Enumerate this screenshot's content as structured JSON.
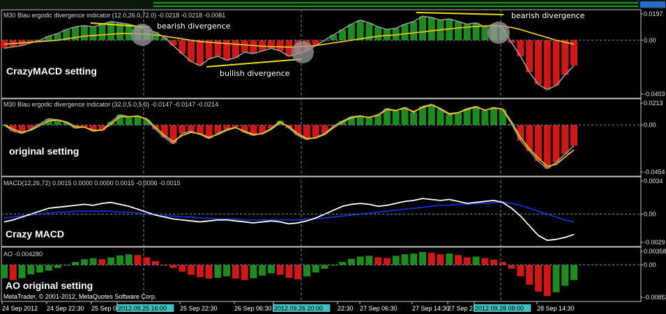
{
  "colors": {
    "background": "#000000",
    "panel_border": "#c8c8c8",
    "grid": "#6a8a9a",
    "bar_up": "#1f8a1f",
    "bar_down": "#d01818",
    "line_price": "#9a9a9a",
    "line_signal": "#e8c020",
    "macd_main": "#ffffff",
    "macd_signal": "#1030d0",
    "annotation_line": "#f0e000",
    "highlight_bg": "#40c0c0"
  },
  "chart_data": [
    {
      "type": "bar",
      "panel": 1,
      "header": "M30 Blau ergodic divergence indicator (12.0,26.0,72.0) -0.0218 -0.0218 -0.0081",
      "setting_label": "CrazyMACD setting",
      "y_ticks": [
        "0.0197",
        "0.00",
        "-0.0403"
      ],
      "ylim": [
        -0.0403,
        0.0197
      ],
      "annotations": [
        "bearish divergence",
        "bullish divergence",
        "bearish divergence"
      ],
      "series": [
        {
          "name": "",
          "type": "bar",
          "values": [
            -0.006,
            -0.005,
            -0.004,
            -0.002,
            0.0,
            0.003,
            0.005,
            0.008,
            0.01,
            0.011,
            0.01,
            0.012,
            0.014,
            0.013,
            0.012,
            0.01,
            0.008,
            0.006,
            0.002,
            -0.004,
            -0.01,
            -0.016,
            -0.019,
            -0.014,
            -0.012,
            -0.015,
            -0.013,
            -0.009,
            -0.01,
            -0.008,
            -0.006,
            -0.008,
            -0.012,
            -0.01,
            -0.008,
            -0.004,
            0.0,
            0.004,
            0.008,
            0.012,
            0.015,
            0.013,
            0.01,
            0.008,
            0.009,
            0.012,
            0.014,
            0.018,
            0.017,
            0.015,
            0.016,
            0.014,
            0.012,
            0.013,
            0.01,
            0.012,
            0.009,
            -0.002,
            -0.012,
            -0.024,
            -0.033,
            -0.037,
            -0.034,
            -0.026,
            -0.019
          ]
        },
        {
          "name": "",
          "type": "line",
          "values": [
            -0.003,
            -0.0025,
            -0.002,
            -0.0015,
            -0.001,
            -0.0005,
            0.0,
            0.001,
            0.002,
            0.003,
            0.0035,
            0.004,
            0.0045,
            0.005,
            0.005,
            0.0048,
            0.0045,
            0.004,
            0.003,
            0.002,
            0.001,
            0.0,
            -0.001,
            -0.0015,
            -0.002,
            -0.0025,
            -0.003,
            -0.0035,
            -0.004,
            -0.0045,
            -0.0048,
            -0.005,
            -0.0052,
            -0.005,
            -0.0045,
            -0.004,
            -0.003,
            -0.002,
            -0.001,
            0.0,
            0.001,
            0.002,
            0.003,
            0.0035,
            0.004,
            0.0048,
            0.0055,
            0.0062,
            0.007,
            0.0078,
            0.0085,
            0.0092,
            0.0098,
            0.0103,
            0.0107,
            0.0108,
            0.0105,
            0.0095,
            0.008,
            0.006,
            0.004,
            0.002,
            0.0,
            -0.0015,
            -0.003
          ]
        }
      ]
    },
    {
      "type": "bar",
      "panel": 2,
      "header": "M30 Blau ergodic divergence indicator (32.0,5.0,5.0) -0.0147 -0.0147 -0.0214",
      "setting_label": "original setting",
      "y_ticks": [
        "0.0213",
        "0.00",
        "-0.0454"
      ],
      "ylim": [
        -0.0454,
        0.0213
      ],
      "series": [
        {
          "name": "",
          "type": "bar",
          "values": [
            0.0,
            -0.006,
            -0.008,
            -0.004,
            0.001,
            0.006,
            0.005,
            0.002,
            -0.003,
            -0.002,
            -0.006,
            -0.005,
            0.003,
            0.01,
            0.008,
            0.009,
            0.005,
            -0.004,
            -0.012,
            -0.018,
            -0.008,
            -0.006,
            -0.009,
            -0.013,
            -0.008,
            -0.004,
            -0.002,
            -0.007,
            -0.01,
            -0.008,
            -0.003,
            0.004,
            -0.003,
            -0.01,
            -0.014,
            -0.012,
            -0.008,
            -0.001,
            0.004,
            0.008,
            0.009,
            0.007,
            0.01,
            0.016,
            0.014,
            0.017,
            0.012,
            0.018,
            0.02,
            0.015,
            0.01,
            0.012,
            0.016,
            0.018,
            0.014,
            0.017,
            0.015,
            0.001,
            -0.015,
            -0.025,
            -0.035,
            -0.042,
            -0.036,
            -0.028,
            -0.02
          ]
        },
        {
          "name": "",
          "type": "line",
          "values": [
            0.0005,
            -0.004,
            -0.007,
            -0.005,
            -0.0005,
            0.004,
            0.005,
            0.003,
            -0.0015,
            -0.002,
            -0.005,
            -0.005,
            0.001,
            0.008,
            0.008,
            0.0085,
            0.006,
            -0.002,
            -0.01,
            -0.016,
            -0.01,
            -0.007,
            -0.0085,
            -0.012,
            -0.009,
            -0.005,
            -0.0025,
            -0.006,
            -0.009,
            -0.0085,
            -0.004,
            0.0025,
            -0.0015,
            -0.0085,
            -0.013,
            -0.0125,
            -0.009,
            -0.0025,
            0.003,
            0.007,
            0.0085,
            0.0075,
            0.0095,
            0.015,
            0.014,
            0.0165,
            0.013,
            0.017,
            0.0195,
            0.016,
            0.011,
            0.012,
            0.015,
            0.0175,
            0.0145,
            0.0165,
            0.0155,
            0.003,
            -0.012,
            -0.023,
            -0.032,
            -0.04,
            -0.038,
            -0.031,
            -0.024
          ]
        }
      ]
    },
    {
      "type": "line",
      "panel": 3,
      "header": "MACD(12,26,72) 0.0015 0.0000 0.0000 0.0015 -0.0006 -0.0015",
      "setting_label": "Crazy MACD",
      "y_ticks": [
        "0.0034",
        "0.00",
        "-0.0029"
      ],
      "ylim": [
        -0.0029,
        0.0034
      ],
      "series": [
        {
          "name": "",
          "values": [
            -0.0008,
            -0.0006,
            -0.0003,
            0.0,
            0.0003,
            0.0006,
            0.0007,
            0.0008,
            0.0009,
            0.001,
            0.0009,
            0.0011,
            0.0012,
            0.001,
            0.0008,
            0.0005,
            0.0002,
            -0.0001,
            -0.0003,
            -0.0005,
            -0.0006,
            -0.0007,
            -0.0008,
            -0.0007,
            -0.0006,
            -0.0006,
            -0.0007,
            -0.0008,
            -0.0009,
            -0.0008,
            -0.0007,
            -0.0008,
            -0.001,
            -0.0009,
            -0.0007,
            -0.0004,
            0.0,
            0.0004,
            0.0008,
            0.001,
            0.0011,
            0.001,
            0.0008,
            0.0009,
            0.0011,
            0.0013,
            0.0014,
            0.0016,
            0.0015,
            0.0014,
            0.0015,
            0.0013,
            0.0011,
            0.0012,
            0.0013,
            0.0014,
            0.0012,
            0.0006,
            -0.0002,
            -0.0012,
            -0.0022,
            -0.0027,
            -0.0026,
            -0.0024,
            -0.0021
          ]
        },
        {
          "name": "",
          "values": [
            -0.0004,
            -0.0003,
            -0.0002,
            -0.0001,
            0.0,
            0.0001,
            0.0002,
            0.0002,
            0.0003,
            0.0003,
            0.0003,
            0.0003,
            0.0003,
            0.0002,
            0.0002,
            0.0001,
            0.0,
            -0.0001,
            -0.0002,
            -0.0002,
            -0.0003,
            -0.0003,
            -0.0004,
            -0.0004,
            -0.0005,
            -0.0005,
            -0.0005,
            -0.0006,
            -0.0006,
            -0.0006,
            -0.0006,
            -0.0006,
            -0.0006,
            -0.0006,
            -0.0005,
            -0.0005,
            -0.0004,
            -0.0003,
            -0.0002,
            -0.0001,
            0.0,
            0.0001,
            0.0002,
            0.0003,
            0.0004,
            0.0005,
            0.0006,
            0.0007,
            0.0008,
            0.0009,
            0.0009,
            0.001,
            0.001,
            0.0011,
            0.0011,
            0.0012,
            0.0012,
            0.0011,
            0.0009,
            0.0006,
            0.0003,
            0.0,
            -0.0003,
            -0.0006,
            -0.0008
          ]
        }
      ]
    },
    {
      "type": "bar",
      "panel": 4,
      "header": "AO -0.004280",
      "setting_label": "AO original setting",
      "y_ticks": [
        "0.00358",
        "0.00",
        "-0.00853"
      ],
      "ylim": [
        -0.00853,
        0.00358
      ],
      "series": [
        {
          "name": "",
          "values": [
            -0.0035,
            -0.004,
            -0.0035,
            -0.0025,
            -0.002,
            -0.0015,
            -0.0008,
            0.0,
            0.0008,
            0.0015,
            0.0018,
            0.0015,
            0.002,
            0.0025,
            0.0028,
            0.0026,
            0.002,
            0.001,
            0.0,
            -0.0008,
            -0.0018,
            -0.0026,
            -0.0032,
            -0.0036,
            -0.0034,
            -0.003,
            -0.0036,
            -0.004,
            -0.0035,
            -0.0028,
            -0.0022,
            -0.0026,
            -0.0034,
            -0.0038,
            -0.003,
            -0.002,
            -0.001,
            0.0,
            0.0008,
            0.0016,
            0.0022,
            0.0024,
            0.002,
            0.0018,
            0.0024,
            0.0028,
            0.003,
            0.0034,
            0.0032,
            0.0028,
            0.003,
            0.0026,
            0.002,
            0.0022,
            0.0018,
            0.0014,
            0.0008,
            -0.001,
            -0.003,
            -0.0052,
            -0.007,
            -0.0082,
            -0.0072,
            -0.0055,
            -0.004
          ]
        }
      ]
    }
  ],
  "x_axis": {
    "labels": [
      "24 Sep 2012",
      "24 Sep 22:30",
      "25 Sep 0",
      "2012.09.25 16:00",
      "25 Sep 22:30",
      "26 Sep 06:30",
      "2012.09.26 20:00",
      "22:30",
      "27 Sep 06:30",
      "27 Sep 14:30",
      "27 Sep 2",
      "2012.09.28 08:00",
      "28 Sep 14:30"
    ],
    "highlighted": [
      "2012.09.25 16:00",
      "2012.09.26 20:00",
      "2012.09.28 08:00"
    ]
  },
  "footer": "MetaTrader, © 2001-2012, MetaQuotes Software Corp."
}
